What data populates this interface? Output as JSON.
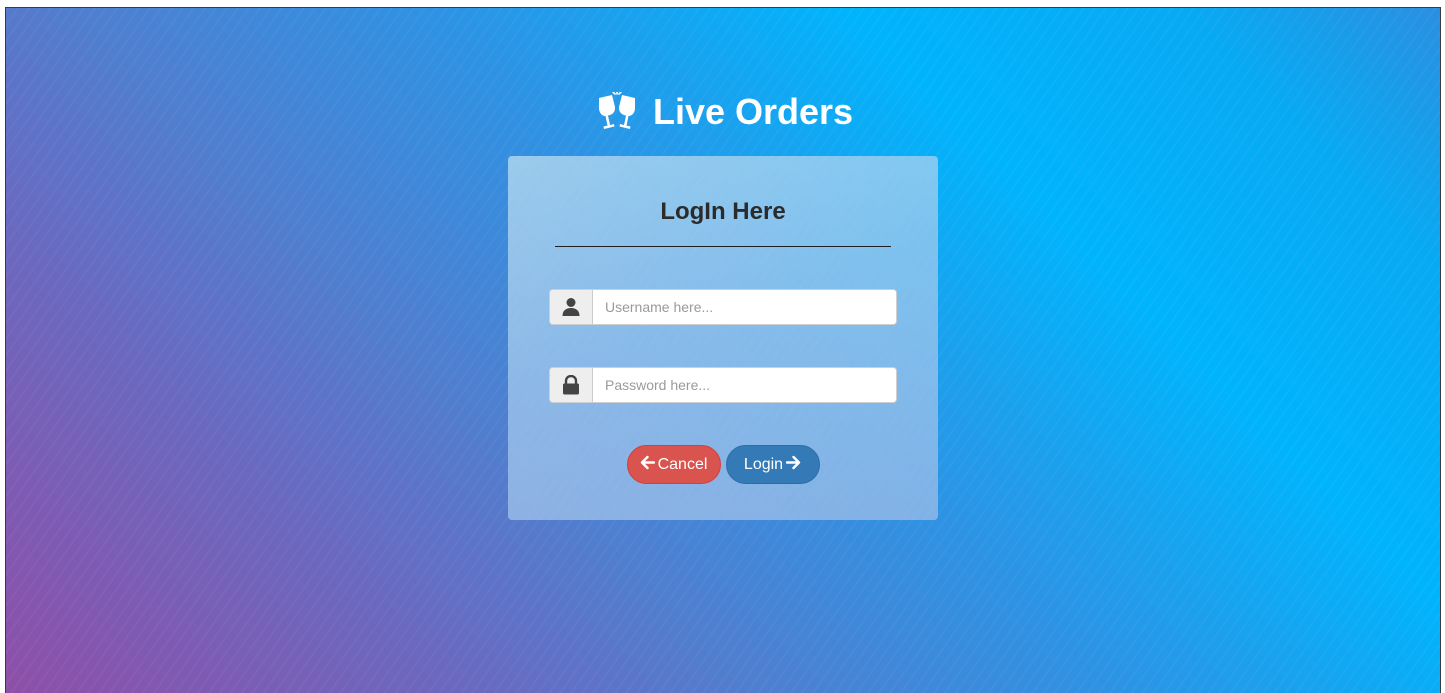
{
  "app": {
    "brand_title": "Live Orders",
    "brand_icon": "glasses-cheers-icon"
  },
  "login_card": {
    "title": "LogIn Here",
    "username": {
      "icon": "user-icon",
      "value": "",
      "placeholder": "Username here..."
    },
    "password": {
      "icon": "lock-icon",
      "value": "",
      "placeholder": "Password here..."
    },
    "cancel_button": {
      "label": "Cancel",
      "icon": "arrow-left-icon"
    },
    "login_button": {
      "label": "Login",
      "icon": "arrow-right-icon"
    }
  },
  "colors": {
    "cancel": "#d9534f",
    "login": "#337ab7",
    "title_text": "#2b2b2b"
  }
}
